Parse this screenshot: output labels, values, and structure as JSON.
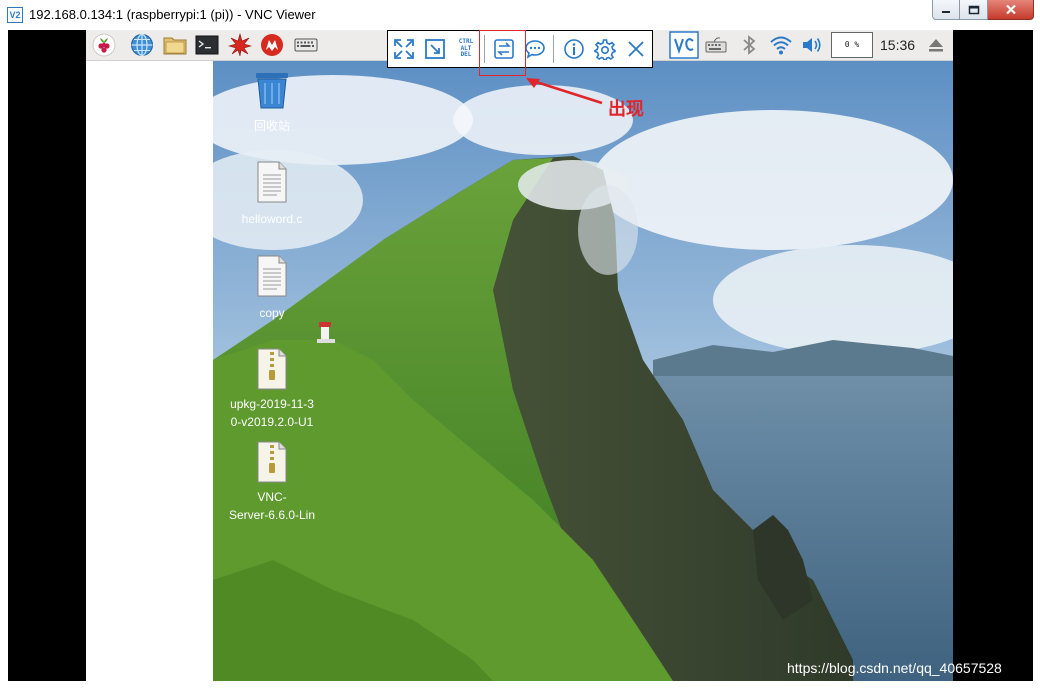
{
  "window": {
    "title": "192.168.0.134:1 (raspberrypi:1 (pi)) - VNC Viewer",
    "app_icon_text": "V2"
  },
  "taskbar": {
    "launchers": [
      "raspberry-menu-icon",
      "web-browser-icon",
      "file-manager-icon",
      "terminal-icon",
      "mathematica-icon",
      "wolfram-icon",
      "keyboard-icon"
    ],
    "tray": [
      "vnc-server-icon",
      "keyboard-layout-icon",
      "bluetooth-icon",
      "wifi-icon",
      "volume-icon"
    ],
    "cpu_label": "0 %",
    "clock": "15:36"
  },
  "vnc_toolbar": {
    "buttons": [
      "fullscreen-icon",
      "scale-icon",
      "ctrl-alt-del-icon",
      "file-transfer-icon",
      "chat-icon",
      "info-icon",
      "settings-icon",
      "close-icon"
    ],
    "ctrl_alt_del": [
      "CTRL",
      "ALT",
      "DEL"
    ]
  },
  "desktop": {
    "icons": [
      {
        "label": "回收站",
        "type": "trash"
      },
      {
        "label": "helloword.c",
        "type": "file"
      },
      {
        "label": "copy",
        "type": "file"
      },
      {
        "label": "upkg-2019-11-30-v2019.2.0-U1",
        "line1": "upkg-2019-11-3",
        "line2": "0-v2019.2.0-U1",
        "type": "archive"
      },
      {
        "label": "VNC-Server-6.6.0-Lin",
        "line1": "VNC-",
        "line2": "Server-6.6.0-Lin",
        "type": "archive"
      }
    ]
  },
  "annotation": {
    "text": "出现",
    "color": "#e0262a"
  },
  "watermark": "https://blog.csdn.net/qq_40657528",
  "colors": {
    "accent": "#2a7ac9",
    "taskbar_bg": "#edeceb",
    "highlight": "#e0262a"
  }
}
